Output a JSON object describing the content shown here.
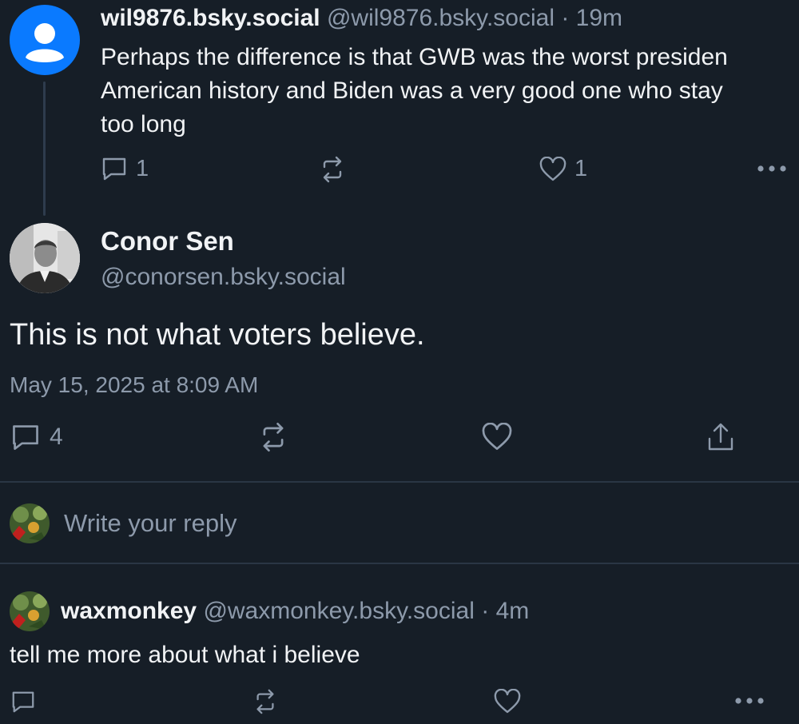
{
  "parent_post": {
    "display_name": "wil9876.bsky.social",
    "handle": "@wil9876.bsky.social",
    "separator": "·",
    "age": "19m",
    "text_lines": [
      "Perhaps the difference is that GWB was the worst presiden",
      "American history and Biden was a very good one who stay",
      "too long"
    ],
    "reply_count": "1",
    "like_count": "1"
  },
  "main_post": {
    "display_name": "Conor Sen",
    "handle": "@conorsen.bsky.social",
    "text": "This is not what voters believe.",
    "timestamp": "May 15, 2025 at 8:09 AM",
    "reply_count": "4"
  },
  "composer": {
    "placeholder": "Write your reply"
  },
  "reply_post": {
    "display_name": "waxmonkey",
    "handle": "@waxmonkey.bsky.social",
    "separator": "·",
    "age": "4m",
    "text": "tell me more about what i believe"
  },
  "colors": {
    "background": "#161e27",
    "text_primary": "#f1f3f5",
    "text_muted": "#8d9aab",
    "default_avatar": "#0a7aff",
    "divider": "#2a3644"
  },
  "icons": [
    "person-icon",
    "comment-icon",
    "repost-icon",
    "heart-icon",
    "share-icon",
    "more-icon"
  ]
}
